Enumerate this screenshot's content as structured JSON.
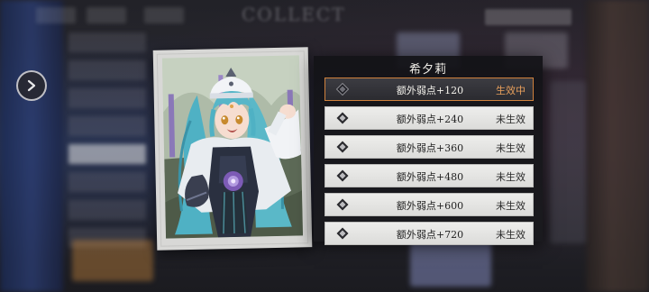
{
  "background": {
    "title": "COLLECT"
  },
  "character": {
    "name": "希夕莉"
  },
  "levels": [
    {
      "label": "额外弱点+120",
      "status": "生效中",
      "active": true
    },
    {
      "label": "额外弱点+240",
      "status": "未生效",
      "active": false
    },
    {
      "label": "额外弱点+360",
      "status": "未生效",
      "active": false
    },
    {
      "label": "额外弱点+480",
      "status": "未生效",
      "active": false
    },
    {
      "label": "额外弱点+600",
      "status": "未生效",
      "active": false
    },
    {
      "label": "额外弱点+720",
      "status": "未生效",
      "active": false
    }
  ],
  "colors": {
    "active_accent": "#d0813d",
    "active_status": "#e8a05c",
    "row_bg": "#e6e6e4",
    "panel_bg": "#16161a"
  },
  "icons": {
    "nav": "chevron-right-icon",
    "level": "diamond-icon"
  }
}
